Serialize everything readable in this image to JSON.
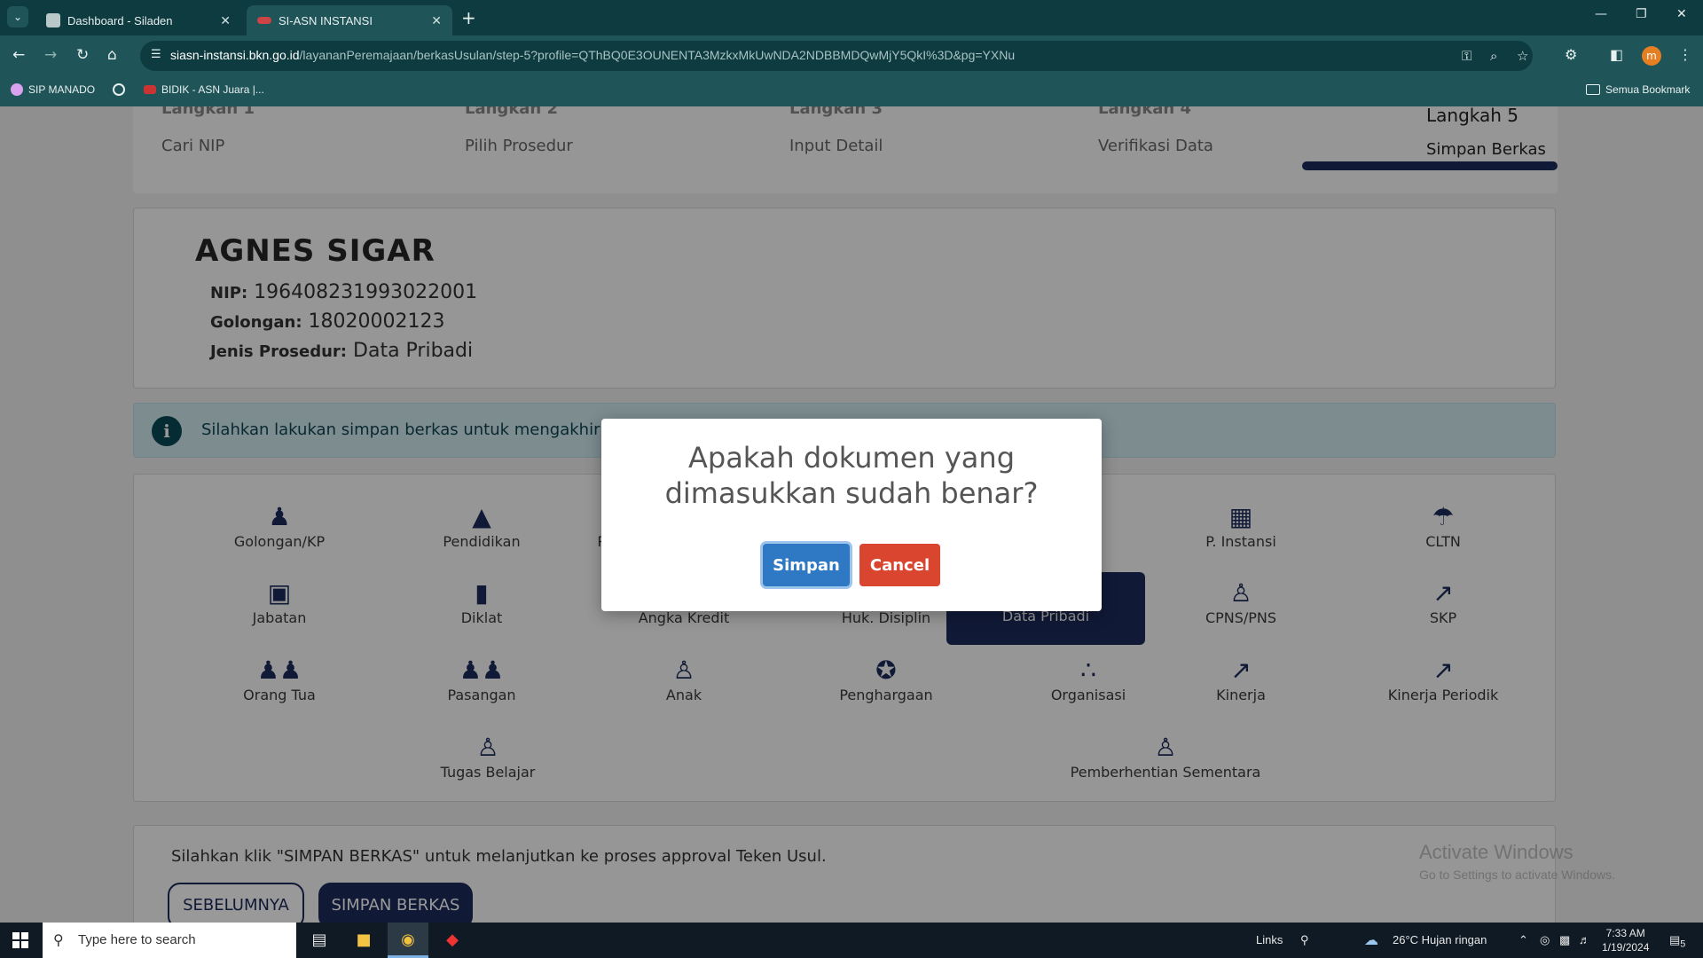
{
  "browser": {
    "tabs": [
      {
        "title": "Dashboard - Siladen"
      },
      {
        "title": "SI-ASN INSTANSI"
      }
    ],
    "url_host": "siasn-instansi.bkn.go.id",
    "url_path": "/layananPeremajaan/berkasUsulan/step-5?profile=QThBQ0E3OUNENTA3MzkxMkUwNDA2NDBBMDQwMjY5QkI%3D&pg=YXNu",
    "profile_initial": "m",
    "bookmarks": [
      {
        "label": "SIP MANADO"
      },
      {
        "label": "BIDIK - ASN Juara |..."
      }
    ],
    "bookmark_folder": "Semua Bookmark"
  },
  "steps": [
    {
      "small": "Langkah 1",
      "label": "Cari NIP"
    },
    {
      "small": "Langkah 2",
      "label": "Pilih Prosedur"
    },
    {
      "small": "Langkah 3",
      "label": "Input Detail"
    },
    {
      "small": "Langkah 4",
      "label": "Verifikasi Data"
    },
    {
      "small": "Langkah 5",
      "label": "Simpan Berkas"
    }
  ],
  "profile": {
    "name": "AGNES SIGAR",
    "nip_label": "NIP:",
    "nip": "196408231993022001",
    "golongan_label": "Golongan:",
    "golongan": "18020002123",
    "prosedur_label": "Jenis Prosedur:",
    "prosedur": "Data Pribadi"
  },
  "alert": {
    "text": "Silahkan lakukan simpan berkas untuk mengakhiri proses i"
  },
  "menu": [
    {
      "label": "Golongan/KP",
      "icon": "user-up-icon"
    },
    {
      "label": "Pendidikan",
      "icon": "graduation-cap-icon"
    },
    {
      "label": "Pend",
      "icon": "book-icon"
    },
    {
      "label": "P. Instansi",
      "icon": "building-icon"
    },
    {
      "label": "CLTN",
      "icon": "umbrella-beach-icon"
    },
    {
      "label": "Jabatan",
      "icon": "id-badge-icon"
    },
    {
      "label": "Diklat",
      "icon": "book-icon"
    },
    {
      "label": "Angka Kredit",
      "icon": "list-icon"
    },
    {
      "label": "Huk. Disiplin",
      "icon": "gavel-icon"
    },
    {
      "label": "Data Pribadi",
      "icon": "user-icon"
    },
    {
      "label": "CPNS/PNS",
      "icon": "user-check-icon"
    },
    {
      "label": "SKP",
      "icon": "chart-line-icon"
    },
    {
      "label": "Orang Tua",
      "icon": "family-icon"
    },
    {
      "label": "Pasangan",
      "icon": "couple-icon"
    },
    {
      "label": "Anak",
      "icon": "child-icon"
    },
    {
      "label": "Penghargaan",
      "icon": "medal-icon"
    },
    {
      "label": "Organisasi",
      "icon": "network-icon"
    },
    {
      "label": "Kinerja",
      "icon": "chart-line-icon"
    },
    {
      "label": "Kinerja Periodik",
      "icon": "chart-line-icon"
    },
    {
      "label": "Tugas Belajar",
      "icon": "user-check-icon"
    },
    {
      "label": "Pemberhentian Sementara",
      "icon": "user-check-icon"
    }
  ],
  "bottom": {
    "text": "Silahkan klik \"SIMPAN BERKAS\" untuk melanjutkan ke proses approval Teken Usul.",
    "prev_label": "SEBELUMNYA",
    "save_label": "SIMPAN BERKAS"
  },
  "watermark": {
    "line1": "Activate Windows",
    "line2": "Go to Settings to activate Windows."
  },
  "modal": {
    "title_line1": "Apakah dokumen yang",
    "title_line2": "dimasukkan sudah benar?",
    "confirm_label": "Simpan",
    "cancel_label": "Cancel"
  },
  "taskbar": {
    "search_placeholder": "Type here to search",
    "links_label": "Links",
    "weather": "26°C  Hujan ringan",
    "time": "7:33 AM",
    "date": "1/19/2024",
    "notifications": "5"
  },
  "colors": {
    "navy": "#1b2a5b",
    "confirm_blue": "#2f78c4",
    "cancel_red": "#d9452f",
    "chrome_teal": "#1f5458"
  }
}
